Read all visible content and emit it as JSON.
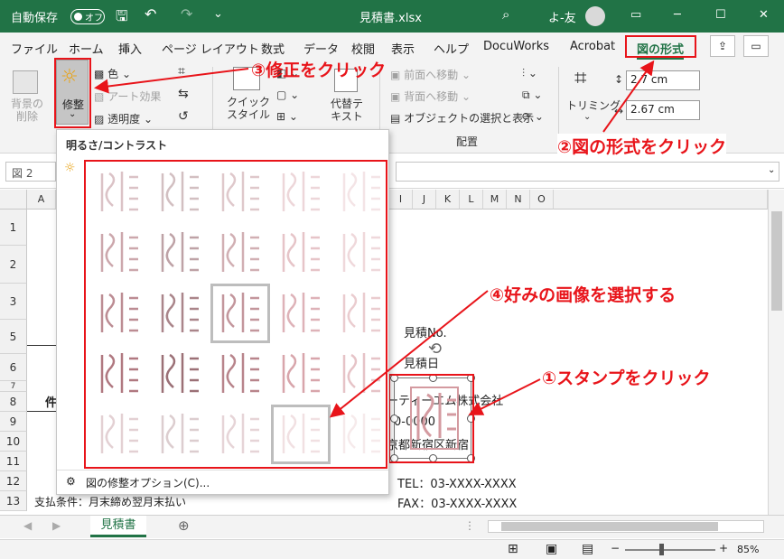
{
  "titlebar": {
    "autosave_label": "自動保存",
    "autosave_state": "オフ",
    "filename": "見積書.xlsx",
    "user_name": "よ-友"
  },
  "tabs": [
    "ファイル",
    "ホーム",
    "挿入",
    "ページ レイアウト",
    "数式",
    "データ",
    "校閲",
    "表示",
    "ヘルプ",
    "DocuWorks",
    "Acrobat",
    "図の形式"
  ],
  "ribbon": {
    "remove_bg": "背景の削除",
    "corrections": "修整",
    "color": "色",
    "artistic_effects": "アート効果",
    "transparency": "透明度",
    "quick_styles": "クイック スタイル",
    "alt_text": "代替テ キスト",
    "bring_forward": "前面へ移動",
    "send_backward": "背面へ移動",
    "selection_pane": "オブジェクトの選択と表示",
    "arrange_group": "配置",
    "crop": "トリミング",
    "height": "2.7 cm",
    "width": "2.67 cm"
  },
  "formula": {
    "name_box": "図 2"
  },
  "dropdown": {
    "header": "明るさ/コントラスト",
    "options_link": "図の修整オプション(C)..."
  },
  "columns": [
    "A",
    "I",
    "J",
    "K",
    "L",
    "M",
    "N",
    "O"
  ],
  "rows": [
    "1",
    "2",
    "3",
    "5",
    "6",
    "7",
    "8",
    "9",
    "10",
    "11",
    "12",
    "13"
  ],
  "cells": {
    "estimate_no": "見積No.",
    "estimate_date": "見積日",
    "company": "ーティーエム株式会社",
    "postal": "0-0000",
    "address": "京都新宿区新宿",
    "tel": "TEL：03-XXXX-XXXX",
    "fax": "FAX：03-XXXX-XXXX",
    "payment": "支払条件：月末締め翌月末払い",
    "row8_a": "件"
  },
  "sheet_tab": "見積書",
  "zoom": "85%",
  "annotations": {
    "a1": "①スタンプをクリック",
    "a2": "②図の形式をクリック",
    "a3": "③修正をクリック",
    "a4": "④好みの画像を選択する"
  },
  "colors": {
    "excel_green": "#217346",
    "annotation_red": "#e8141a"
  }
}
